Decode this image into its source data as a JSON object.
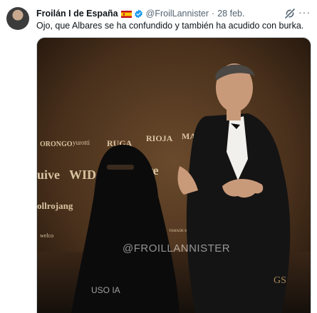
{
  "tweet": {
    "display_name": "Froilán I de España",
    "handle": "@FroilLannister",
    "separator": "·",
    "date": "28 feb.",
    "text": "Ojo, que Albares se ha confundido y también ha acudido con burka.",
    "more_label": "···"
  },
  "media": {
    "backdrop_logos": [
      "ORONGO",
      "yurotti",
      "RUGA",
      "RIOJA",
      "MA",
      "uive",
      "WIDA",
      "aere",
      "ollrojang",
      "welco",
      "TAMADE HOSTAGE"
    ],
    "watermark": "@FROILLANNISTER",
    "caption": "USO IA",
    "corner_mark": "GS"
  },
  "icons": {
    "verified": "verified-badge-icon",
    "grok": "grok-icon",
    "flag": "spain-flag-icon",
    "more": "more-options-icon"
  },
  "colors": {
    "verified": "#1d9bf0",
    "muted_text": "#536471",
    "flag_red": "#c60b1e",
    "flag_yellow": "#ffc400"
  }
}
